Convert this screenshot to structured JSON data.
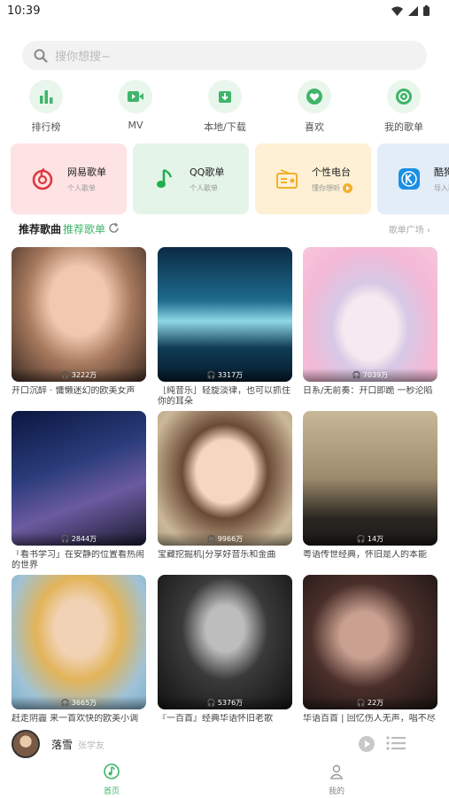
{
  "status": {
    "time": "10:39"
  },
  "search": {
    "placeholder": "搜你想搜~"
  },
  "quick_nav": [
    {
      "label": "排行榜",
      "icon": "bar-chart-icon"
    },
    {
      "label": "MV",
      "icon": "video-icon"
    },
    {
      "label": "本地/下载",
      "icon": "download-icon"
    },
    {
      "label": "喜欢",
      "icon": "heart-icon"
    },
    {
      "label": "我的歌单",
      "icon": "playlist-icon"
    }
  ],
  "source_cards": [
    {
      "title": "网易歌单",
      "subtitle": "个人歌单",
      "bg": "#fde3e4",
      "icon": "netease-icon"
    },
    {
      "title": "QQ歌单",
      "subtitle": "个人歌单",
      "bg": "#e4f4e8",
      "icon": "qq-music-icon"
    },
    {
      "title": "个性电台",
      "subtitle": "懂你想听",
      "bg": "#fdf0d4",
      "icon": "radio-icon"
    },
    {
      "title": "酷狗歌单",
      "subtitle": "导入歌单",
      "bg": "#e2edf8",
      "icon": "kugou-icon"
    }
  ],
  "section": {
    "tab_songs": "推荐歌曲",
    "tab_playlists": "推荐歌单",
    "square_link": "歌单广场 ›"
  },
  "playlists": [
    {
      "plays": "3222万",
      "title": "开口沉醉 · 慵懒迷幻的欧美女声"
    },
    {
      "plays": "3317万",
      "title": "［纯音乐］轻旋淡律，也可以抓住你的耳朵"
    },
    {
      "plays": "7039万",
      "title": "日系/无前奏：开口即跪 一秒沦陷"
    },
    {
      "plays": "2844万",
      "title": "「看书学习」在安静的位置看热闹的世界"
    },
    {
      "plays": "9966万",
      "title": "宝藏挖掘机|分享好音乐和金曲"
    },
    {
      "plays": "14万",
      "title": "粤语传世经典，怀旧是人的本能"
    },
    {
      "plays": "3665万",
      "title": "赶走阴霾 来一首欢快的欧美小调"
    },
    {
      "plays": "5376万",
      "title": "『一百首』经典华语怀旧老歌"
    },
    {
      "plays": "22万",
      "title": "华语百首 | 回忆伤人无声，唱不尽"
    }
  ],
  "player": {
    "song": "落雪",
    "artist": "张学友"
  },
  "bottom_nav": [
    {
      "label": "首页",
      "active": true
    },
    {
      "label": "我的",
      "active": false
    }
  ],
  "colors": {
    "accent": "#3fb56a",
    "netease": "#e0373f",
    "kugou": "#1a8fe3",
    "radio": "#f2b02e"
  }
}
